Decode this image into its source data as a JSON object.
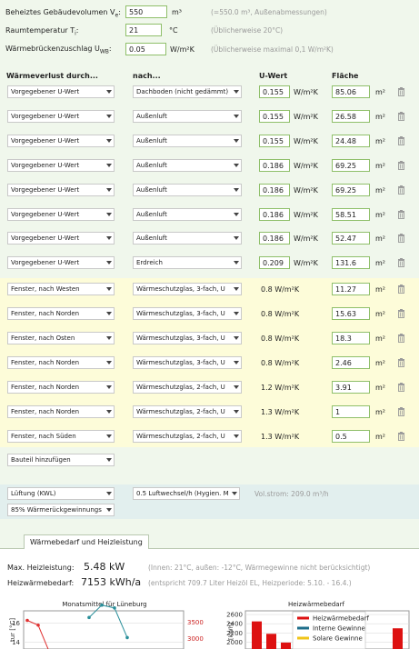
{
  "general": {
    "volume_label": "Beheiztes Gebäudevolumen V",
    "volume_sub": "e",
    "volume_value": "550",
    "volume_unit": "m³",
    "volume_hint": "(=550.0 m³, Außenabmessungen)",
    "temp_label": "Raumtemperatur T",
    "temp_sub": "i",
    "temp_value": "21",
    "temp_unit": "°C",
    "temp_hint": "(Üblicherweise 20°C)",
    "bridge_label": "Wärmebrückenzuschlag U",
    "bridge_sub": "WB",
    "bridge_value": "0.05",
    "bridge_unit": "W/m²K",
    "bridge_hint": "(Üblicherweise maximal 0,1 W/m²K)"
  },
  "table": {
    "col_loss": "Wärmeverlust durch...",
    "col_to": "nach...",
    "col_u": "U-Wert",
    "col_area": "Fläche",
    "u_unit": "W/m²K",
    "area_unit": "m²",
    "opaque_rows": [
      {
        "type": "Vorgegebener U-Wert",
        "to": "Dachboden (nicht gedämmt)",
        "u": "0.155",
        "area": "85.06"
      },
      {
        "type": "Vorgegebener U-Wert",
        "to": "Außenluft",
        "u": "0.155",
        "area": "26.58"
      },
      {
        "type": "Vorgegebener U-Wert",
        "to": "Außenluft",
        "u": "0.155",
        "area": "24.48"
      },
      {
        "type": "Vorgegebener U-Wert",
        "to": "Außenluft",
        "u": "0.186",
        "area": "69.25"
      },
      {
        "type": "Vorgegebener U-Wert",
        "to": "Außenluft",
        "u": "0.186",
        "area": "69.25"
      },
      {
        "type": "Vorgegebener U-Wert",
        "to": "Außenluft",
        "u": "0.186",
        "area": "58.51"
      },
      {
        "type": "Vorgegebener U-Wert",
        "to": "Außenluft",
        "u": "0.186",
        "area": "52.47"
      },
      {
        "type": "Vorgegebener U-Wert",
        "to": "Erdreich",
        "u": "0.209",
        "area": "131.6"
      }
    ],
    "window_rows": [
      {
        "type": "Fenster, nach Westen",
        "to": "Wärmeschutzglas, 3-fach, U",
        "u": "0.8 W/m²K",
        "area": "11.27"
      },
      {
        "type": "Fenster, nach Norden",
        "to": "Wärmeschutzglas, 3-fach, U",
        "u": "0.8 W/m²K",
        "area": "15.63"
      },
      {
        "type": "Fenster, nach Osten",
        "to": "Wärmeschutzglas, 3-fach, U",
        "u": "0.8 W/m²K",
        "area": "18.3"
      },
      {
        "type": "Fenster, nach Norden",
        "to": "Wärmeschutzglas, 3-fach, U",
        "u": "0.8 W/m²K",
        "area": "2.46"
      },
      {
        "type": "Fenster, nach Norden",
        "to": "Wärmeschutzglas, 2-fach, U",
        "u": "1.2 W/m²K",
        "area": "3.91"
      },
      {
        "type": "Fenster, nach Norden",
        "to": "Wärmeschutzglas, 2-fach, U",
        "u": "1.3 W/m²K",
        "area": "1"
      },
      {
        "type": "Fenster, nach Süden",
        "to": "Wärmeschutzglas, 2-fach, U",
        "u": "1.3 W/m²K",
        "area": "0.5"
      }
    ],
    "add_component": "Bauteil hinzufügen"
  },
  "ventilation": {
    "type": "Lüftung (KWL)",
    "rate": "0.5 Luftwechsel/h (Hygien. M",
    "volume_flow": "Vol.strom: 209.0 m³/h",
    "recovery": "85% Wärmerückgewinnungs"
  },
  "results": {
    "tab_label": "Wärmebedarf und Heizleistung",
    "power_label": "Max. Heizleistung:",
    "power_value": "5.48 kW",
    "power_hint": "(Innen: 21°C, außen: -12°C, Wärmegewinne nicht berücksichtigt)",
    "demand_label": "Heizwärmebedarf:",
    "demand_value": "7153 kWh/a",
    "demand_hint": "(entspricht 709.7 Liter Heizöl EL, Heizperiode: 5.10. - 16.4.)"
  },
  "chart_data": [
    {
      "type": "line",
      "title": "Monatsmittel für Lüneburg",
      "ylabel": "tur [°C]",
      "y_ticks": [
        "16",
        "14"
      ],
      "y2_ticks": [
        "3500",
        "3000"
      ],
      "series": [
        {
          "color": "#e03030",
          "values": [
            16.3,
            15.8,
            12.6
          ]
        },
        {
          "color": "#2a8f9a",
          "values": [
            16.6,
            17.9,
            17.6,
            14.5
          ]
        }
      ]
    },
    {
      "type": "bar",
      "title": "Heizwärmebedarf",
      "ylabel": "[kWh]",
      "y_ticks": [
        "2600",
        "2400",
        "2200",
        "2000"
      ],
      "legend": [
        {
          "name": "Heizwärmebedarf",
          "color": "#dd1111"
        },
        {
          "name": "Interne Gewinne",
          "color": "#1f6f8b"
        },
        {
          "name": "Solare Gewinne",
          "color": "#f0c419"
        }
      ]
    }
  ],
  "colors": {
    "background": "#f0f7ec",
    "window_band": "#fdfcd9",
    "vent_band": "#e2efee",
    "input_border": "#8fbf6a"
  }
}
